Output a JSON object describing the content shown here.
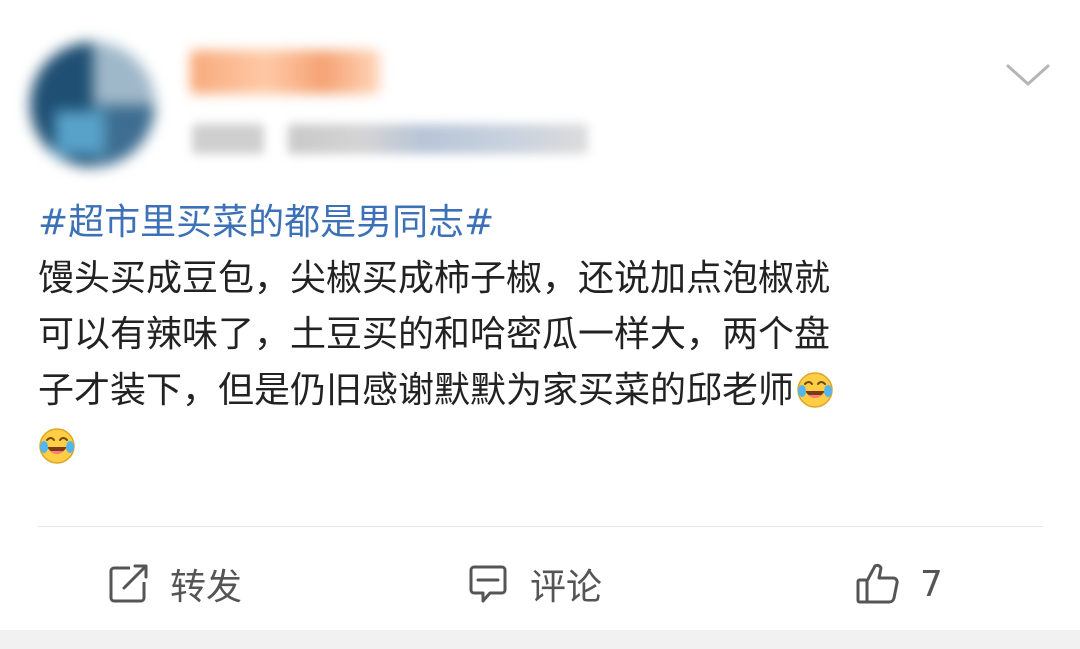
{
  "post": {
    "topic": "#超市里买菜的都是男同志#",
    "body_lines": [
      "馒头买成豆包，尖椒买成柿子椒，还说加点泡椒就",
      "可以有辣味了，土豆买的和哈密瓜一样大，两个盘",
      "子才装下，但是仍旧感谢默默为家买菜的邱老师"
    ],
    "emoji": "laugh-cry-emoji"
  },
  "actions": {
    "repost_label": "转发",
    "comment_label": "评论",
    "like_count": "7"
  },
  "icons": {
    "menu": "chevron-down-icon",
    "repost": "repost-icon",
    "comment": "comment-icon",
    "like": "thumbs-up-icon"
  },
  "colors": {
    "topic": "#3c71b7",
    "text": "#222222",
    "action_text": "#555555",
    "divider": "#e6e6e6"
  }
}
